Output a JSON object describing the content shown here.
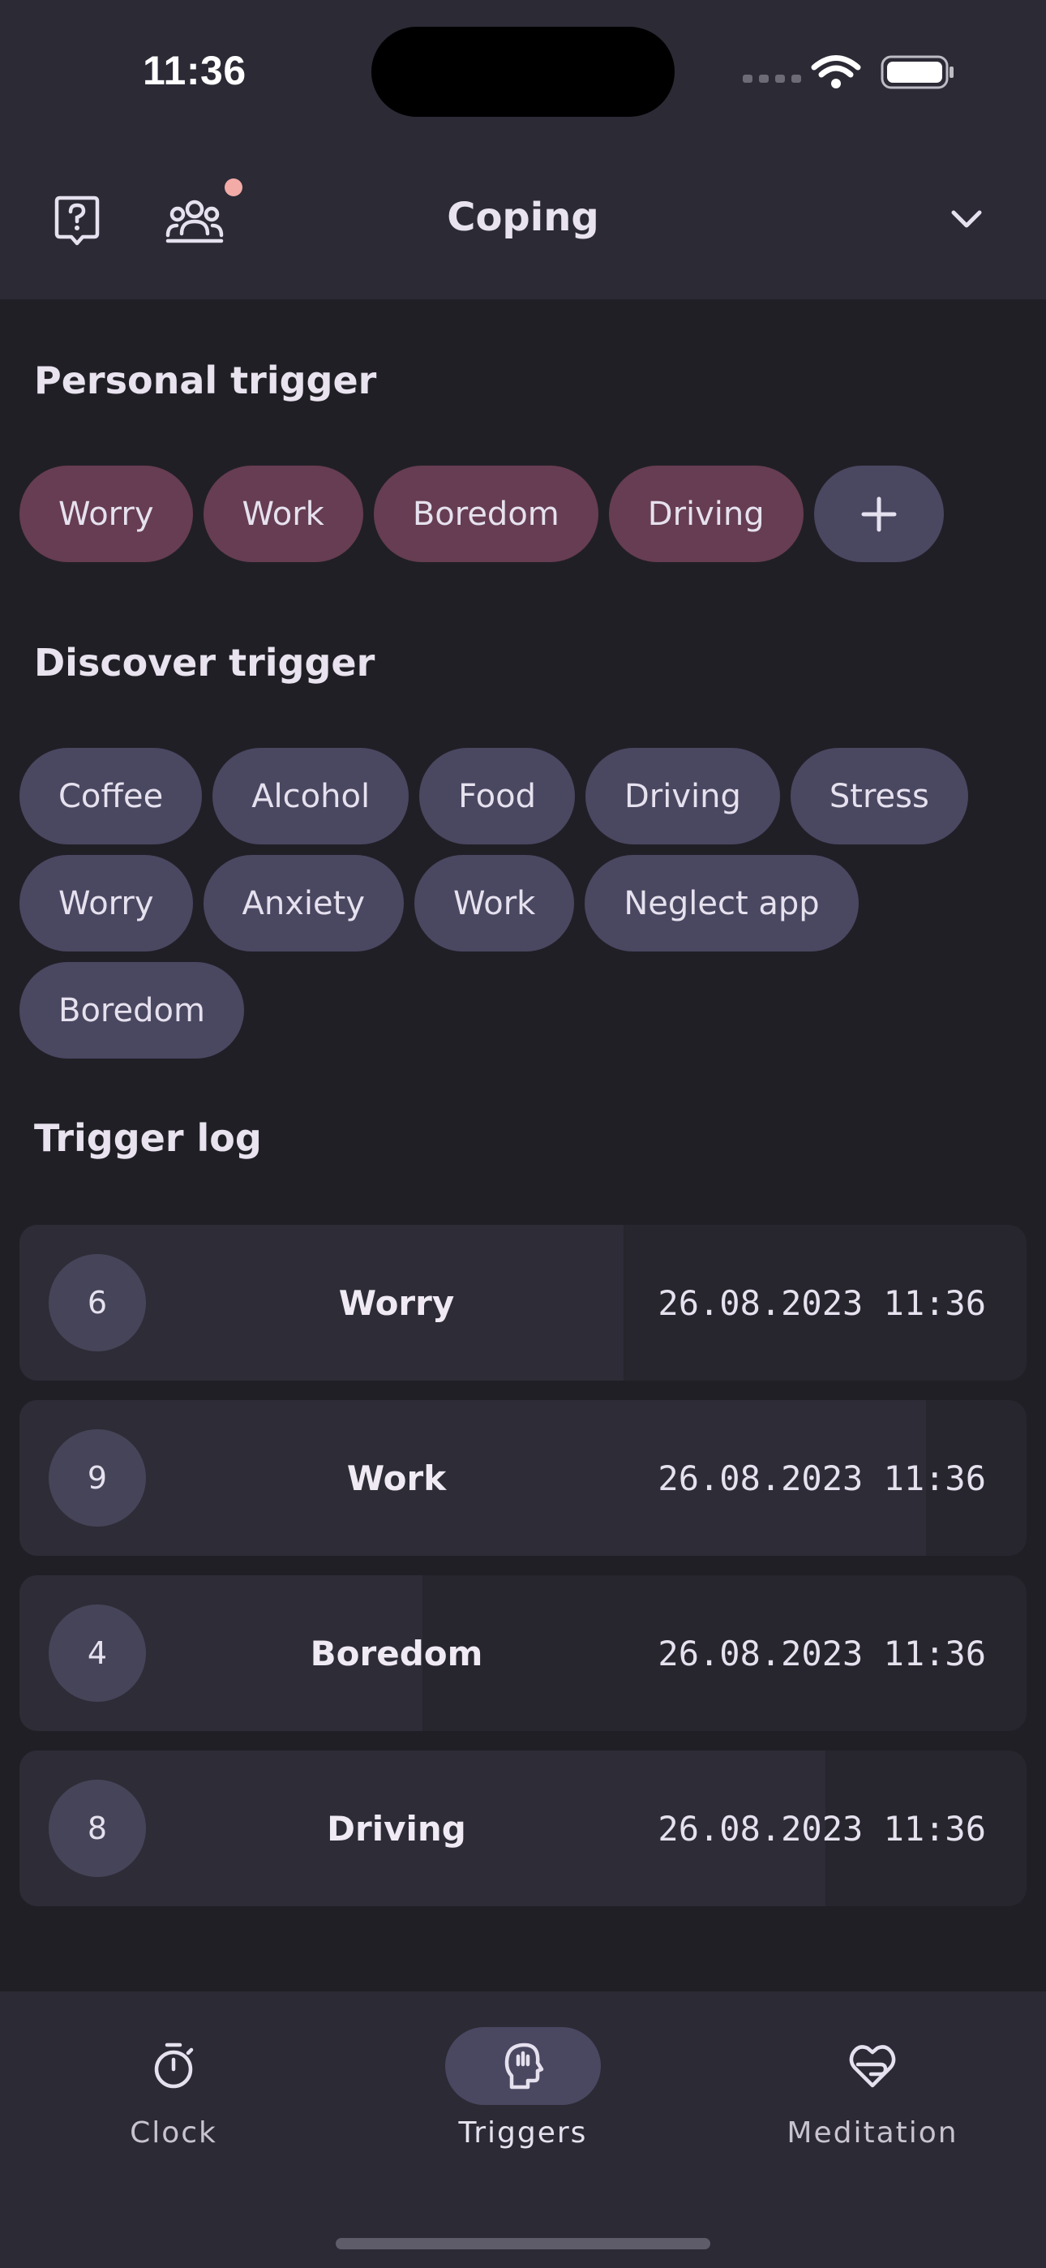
{
  "status_bar": {
    "time": "11:36"
  },
  "app_bar": {
    "title": "Coping"
  },
  "personal": {
    "title": "Personal trigger",
    "chips": [
      "Worry",
      "Work",
      "Boredom",
      "Driving"
    ]
  },
  "discover": {
    "title": "Discover trigger",
    "rows": [
      [
        "Coffee",
        "Alcohol",
        "Food",
        "Driving",
        "Stress"
      ],
      [
        "Worry",
        "Anxiety",
        "Work",
        "Neglect app"
      ],
      [
        "Boredom"
      ]
    ]
  },
  "log": {
    "title": "Trigger log",
    "items": [
      {
        "num": "6",
        "name": "Worry",
        "date": "26.08.2023 11:36",
        "intensity": 0.6
      },
      {
        "num": "9",
        "name": "Work",
        "date": "26.08.2023 11:36",
        "intensity": 0.9
      },
      {
        "num": "4",
        "name": "Boredom",
        "date": "26.08.2023 11:36",
        "intensity": 0.4
      },
      {
        "num": "8",
        "name": "Driving",
        "date": "26.08.2023 11:36",
        "intensity": 0.8
      }
    ]
  },
  "nav": {
    "items": [
      {
        "label": "Clock",
        "icon": "stopwatch-icon",
        "active": false
      },
      {
        "label": "Triggers",
        "icon": "head-icon",
        "active": true
      },
      {
        "label": "Meditation",
        "icon": "heart-hand-icon",
        "active": false
      }
    ]
  },
  "colors": {
    "background": "#211f26",
    "surface": "#2b2a35",
    "personal_chip": "#663d52",
    "discover_chip": "#4a4761",
    "badge": "#f2aba7"
  }
}
